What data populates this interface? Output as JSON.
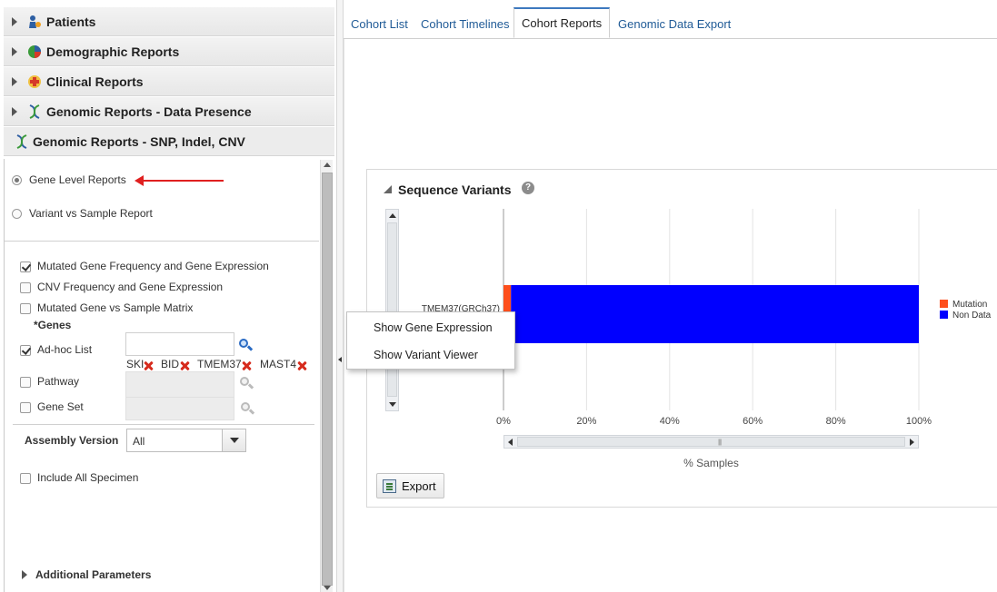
{
  "accordion": [
    {
      "label": "Patients",
      "icon": "patients-icon"
    },
    {
      "label": "Demographic Reports",
      "icon": "pie-chart-icon"
    },
    {
      "label": "Clinical Reports",
      "icon": "medical-cross-icon"
    },
    {
      "label": "Genomic Reports - Data Presence",
      "icon": "dna-icon"
    },
    {
      "label": "Genomic Reports - SNP, Indel, CNV",
      "icon": "dna-icon"
    }
  ],
  "report_type": {
    "options": [
      "Gene Level Reports",
      "Variant vs Sample Report"
    ],
    "selected": "Gene Level Reports"
  },
  "report_checks": [
    {
      "label": "Mutated Gene Frequency and Gene Expression",
      "checked": true
    },
    {
      "label": "CNV Frequency and Gene Expression",
      "checked": false
    },
    {
      "label": "Mutated Gene vs Sample Matrix",
      "checked": false
    }
  ],
  "genes": {
    "heading": "*Genes",
    "adhoc_label": "Ad-hoc List",
    "adhoc_checked": true,
    "adhoc_value": "",
    "items": [
      "SKI",
      "BID",
      "TMEM37",
      "MAST4"
    ],
    "pathway_label": "Pathway",
    "geneset_label": "Gene Set"
  },
  "assembly": {
    "label": "Assembly Version",
    "value": "All"
  },
  "include_all_specimen": {
    "label": "Include All Specimen",
    "checked": false
  },
  "additional_parameters": "Additional Parameters",
  "tabs": {
    "items": [
      "Cohort List",
      "Cohort Timelines",
      "Cohort Reports",
      "Genomic Data Export"
    ],
    "selected": "Cohort Reports"
  },
  "section": {
    "title": "Sequence Variants",
    "help": "?"
  },
  "context_menu": [
    "Show Gene Expression",
    "Show Variant Viewer"
  ],
  "export_label": "Export",
  "colors": {
    "mutation": "#fe4f1c",
    "non_data": "#0000ff",
    "accent": "#3e79bf"
  },
  "chart_data": {
    "type": "bar",
    "orientation": "horizontal",
    "stacked": true,
    "categories": [
      "TMEM37(GRCh37)"
    ],
    "series": [
      {
        "name": "Mutation",
        "values": [
          1.8
        ]
      },
      {
        "name": "Non Data",
        "values": [
          98.2
        ]
      }
    ],
    "xlabel": "% Samples",
    "xlim": [
      0,
      100
    ],
    "xticks": [
      "0%",
      "20%",
      "40%",
      "60%",
      "80%",
      "100%"
    ],
    "grid": true,
    "legend": "right"
  }
}
